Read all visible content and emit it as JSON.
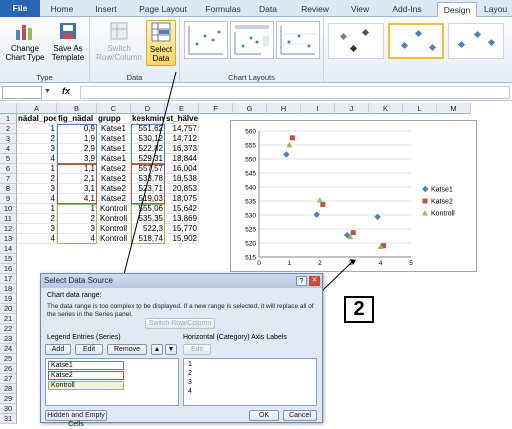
{
  "tabs": [
    "File",
    "Home",
    "Insert",
    "Page Layout",
    "Formulas",
    "Data",
    "Review",
    "View",
    "Add-Ins",
    "Design",
    "Layou"
  ],
  "ribbon": {
    "change_type": "Change Chart Type",
    "save_template": "Save As Template",
    "type_group": "Type",
    "switch": "Switch Row/Column",
    "select_data": "Select Data",
    "data_group": "Data",
    "layouts_group": "Chart Layouts"
  },
  "formula": {
    "fx": "fx"
  },
  "columns": [
    "A",
    "B",
    "C",
    "D",
    "E",
    "F",
    "G",
    "H",
    "I",
    "J",
    "K",
    "L",
    "M"
  ],
  "headers": [
    "nädal_poeg",
    "fig_nädal",
    "grupp",
    "keskmine",
    "st_hälve"
  ],
  "rows": [
    [
      "1",
      "0,9",
      "Katse1",
      "551,62",
      "14,757"
    ],
    [
      "2",
      "1,9",
      "Katse1",
      "530,12",
      "14,712"
    ],
    [
      "3",
      "2,9",
      "Katse1",
      "522,82",
      "16,373"
    ],
    [
      "4",
      "3,9",
      "Katse1",
      "529,31",
      "18,844"
    ],
    [
      "1",
      "1,1",
      "Katse2",
      "557,57",
      "16,004"
    ],
    [
      "2",
      "2,1",
      "Katse2",
      "533,78",
      "18,538"
    ],
    [
      "3",
      "3,1",
      "Katse2",
      "523,71",
      "20,853"
    ],
    [
      "4",
      "4,1",
      "Katse2",
      "519,03",
      "18,075"
    ],
    [
      "1",
      "1",
      "Kontroll",
      "555,06",
      "15,642"
    ],
    [
      "2",
      "2",
      "Kontroll",
      "535,35",
      "13,869"
    ],
    [
      "3",
      "3",
      "Kontroll",
      "522,3",
      "15,770"
    ],
    [
      "4",
      "4",
      "Kontroll",
      "518,74",
      "15,902"
    ]
  ],
  "row_numbers": [
    "1",
    "2",
    "3",
    "4",
    "5",
    "6",
    "7",
    "8",
    "9",
    "10",
    "11",
    "12",
    "13",
    "14",
    "15",
    "16",
    "17",
    "18",
    "19",
    "20",
    "21",
    "22",
    "23",
    "24",
    "25",
    "26",
    "27",
    "28",
    "29",
    "30",
    "31"
  ],
  "colors": {
    "katse1": "#4f81bd",
    "katse2": "#c0504d",
    "kontroll": "#9bbb59"
  },
  "chart_data": {
    "type": "scatter",
    "xlim": [
      0,
      5
    ],
    "ylim": [
      515,
      560
    ],
    "x_ticks": [
      "0",
      "1",
      "2",
      "3",
      "4",
      "5"
    ],
    "y_ticks": [
      "515",
      "520",
      "525",
      "530",
      "535",
      "540",
      "545",
      "550",
      "555",
      "560"
    ],
    "series": [
      {
        "name": "Katse1",
        "x": [
          0.9,
          1.9,
          2.9,
          3.9
        ],
        "y": [
          551.62,
          530.12,
          522.82,
          529.31
        ]
      },
      {
        "name": "Katse2",
        "x": [
          1.1,
          2.1,
          3.1,
          4.1
        ],
        "y": [
          557.57,
          533.78,
          523.71,
          519.03
        ]
      },
      {
        "name": "Kontroll",
        "x": [
          1,
          2,
          3,
          4
        ],
        "y": [
          555.06,
          535.35,
          522.3,
          518.74
        ]
      }
    ],
    "legend": "right"
  },
  "dialog": {
    "title": "Select Data Source",
    "range_label": "Chart data range:",
    "message": "The data range is too complex to be displayed. If a new range is selected, it will replace all of the series in the Series panel.",
    "switch_btn": "Switch Row/Column",
    "legend_label": "Legend Entries (Series)",
    "add": "Add",
    "edit": "Edit",
    "remove": "Remove",
    "axis_label": "Horizontal (Category) Axis Labels",
    "series": [
      "Katse1",
      "Katse2",
      "Kontroll"
    ],
    "categories": [
      "1",
      "2",
      "3",
      "4"
    ],
    "hidden_btn": "Hidden and Empty Cells",
    "ok": "OK",
    "cancel": "Cancel"
  },
  "badge": "2"
}
